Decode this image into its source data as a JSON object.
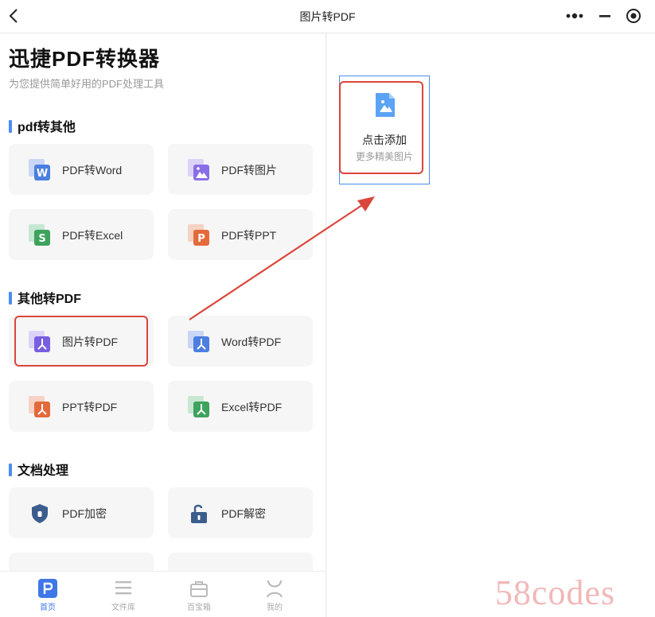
{
  "window": {
    "title": "图片转PDF"
  },
  "header": {
    "title": "迅捷PDF转换器",
    "subtitle": "为您提供简单好用的PDF处理工具"
  },
  "sections": [
    {
      "title": "pdf转其他",
      "items": [
        {
          "label": "PDF转Word",
          "icon": "word-icon",
          "color": "#4b7fe0"
        },
        {
          "label": "PDF转图片",
          "icon": "image-icon",
          "color": "#8a6ee8"
        },
        {
          "label": "PDF转Excel",
          "icon": "excel-icon",
          "color": "#3da35d"
        },
        {
          "label": "PDF转PPT",
          "icon": "ppt-icon",
          "color": "#e46a3b"
        }
      ]
    },
    {
      "title": "其他转PDF",
      "items": [
        {
          "label": "图片转PDF",
          "icon": "pdf-icon",
          "color": "#7a5ee0"
        },
        {
          "label": "Word转PDF",
          "icon": "pdf-icon",
          "color": "#4b7fe0"
        },
        {
          "label": "PPT转PDF",
          "icon": "pdf-icon",
          "color": "#e46a3b"
        },
        {
          "label": "Excel转PDF",
          "icon": "pdf-icon",
          "color": "#3da35d"
        }
      ]
    },
    {
      "title": "文档处理",
      "items": [
        {
          "label": "PDF加密",
          "icon": "shield-icon",
          "color": "#3b5d8c"
        },
        {
          "label": "PDF解密",
          "icon": "unlock-icon",
          "color": "#3b5d8c"
        }
      ]
    }
  ],
  "nav": [
    {
      "label": "首页",
      "icon": "home-icon",
      "active": true
    },
    {
      "label": "文件库",
      "icon": "list-icon",
      "active": false
    },
    {
      "label": "百宝箱",
      "icon": "toolbox-icon",
      "active": false
    },
    {
      "label": "我的",
      "icon": "user-icon",
      "active": false
    }
  ],
  "add_panel": {
    "label": "点击添加",
    "sub": "更多精美图片"
  },
  "watermark": "58codes",
  "colors": {
    "accent": "#4a8ef0",
    "highlight": "#d9473a"
  }
}
